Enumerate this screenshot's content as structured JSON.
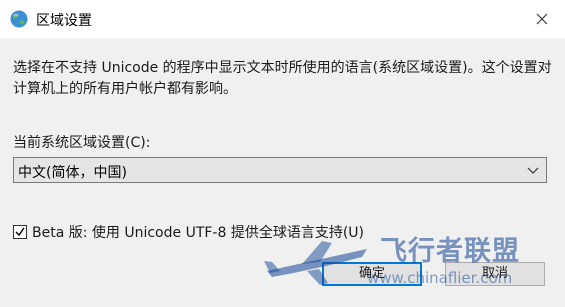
{
  "window": {
    "title": "区域设置",
    "icon": "globe-icon",
    "close_icon": "close-icon"
  },
  "description": "选择在不支持 Unicode 的程序中显示文本时所使用的语言(系统区域设置)。这个设置对计算机上的所有用户帐户都有影响。",
  "locale": {
    "label": "当前系统区域设置(C):",
    "selected": "中文(简体，中国)"
  },
  "beta_option": {
    "label": "Beta 版: 使用 Unicode UTF-8 提供全球语言支持(U)",
    "checked": true
  },
  "buttons": {
    "ok": "确定",
    "cancel": "取消"
  },
  "watermark": {
    "brand": "飞行者联盟",
    "url": "www.chinaflier.com"
  }
}
